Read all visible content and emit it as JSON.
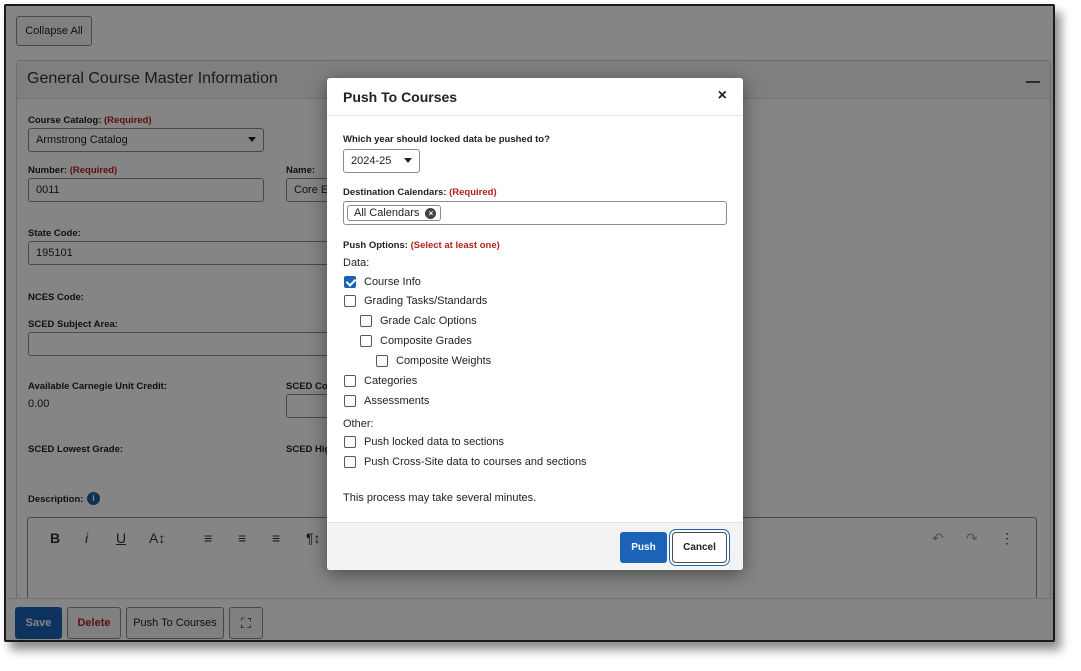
{
  "page": {
    "collapse_all": "Collapse All",
    "section_title": "General Course Master Information",
    "course_catalog_label": "Course Catalog:",
    "required_text": "(Required)",
    "course_catalog_value": "Armstrong Catalog",
    "number_label": "Number:",
    "number_value": "0011",
    "name_label": "Name:",
    "name_value": "Core E",
    "state_code_label": "State Code:",
    "state_code_value": "195101",
    "nces_code_label": "NCES Code:",
    "sced_subject_label": "SCED Subject Area:",
    "carnegie_label": "Available Carnegie Unit Credit:",
    "carnegie_value": "0.00",
    "sced_course_label": "SCED Co",
    "sced_lowest_label": "SCED Lowest Grade:",
    "sced_highest_label": "SCED Hig",
    "description_label": "Description:",
    "info_icon_glyph": "i",
    "toolbar": {
      "bold": "B",
      "italic": "i",
      "underline": "U",
      "font_size": "A↕",
      "align_left": "≡",
      "align_center": "≡",
      "align_right": "≡",
      "paragraph": "¶↕",
      "undo": "↶",
      "redo": "↷",
      "more": "⋮"
    },
    "footer": {
      "save": "Save",
      "delete": "Delete",
      "push_to_courses": "Push To Courses",
      "fullscreen": "⛶"
    }
  },
  "modal": {
    "title": "Push To Courses",
    "close": "×",
    "year_question": "Which year should locked data be pushed to?",
    "year_value": "2024-25",
    "dest_label": "Destination Calendars:",
    "dest_required": "(Required)",
    "chip_label": "All Calendars",
    "chip_remove": "×",
    "push_options_label": "Push Options:",
    "push_options_hint": "(Select at least one)",
    "data_heading": "Data:",
    "options": [
      {
        "label": "Course Info",
        "checked": true
      },
      {
        "label": "Grading Tasks/Standards",
        "checked": false
      },
      {
        "label": "Grade Calc Options",
        "checked": false
      },
      {
        "label": "Composite Grades",
        "checked": false
      },
      {
        "label": "Composite Weights",
        "checked": false
      },
      {
        "label": "Categories",
        "checked": false
      },
      {
        "label": "Assessments",
        "checked": false
      }
    ],
    "other_heading": "Other:",
    "other_options": [
      {
        "label": "Push locked data to sections",
        "checked": false
      },
      {
        "label": "Push Cross-Site data to courses and sections",
        "checked": false
      }
    ],
    "note": "This process may take several minutes.",
    "push_button": "Push",
    "cancel_button": "Cancel"
  },
  "colors": {
    "primary": "#1c63b7",
    "required": "#b32020",
    "delete_text": "#b32020"
  }
}
